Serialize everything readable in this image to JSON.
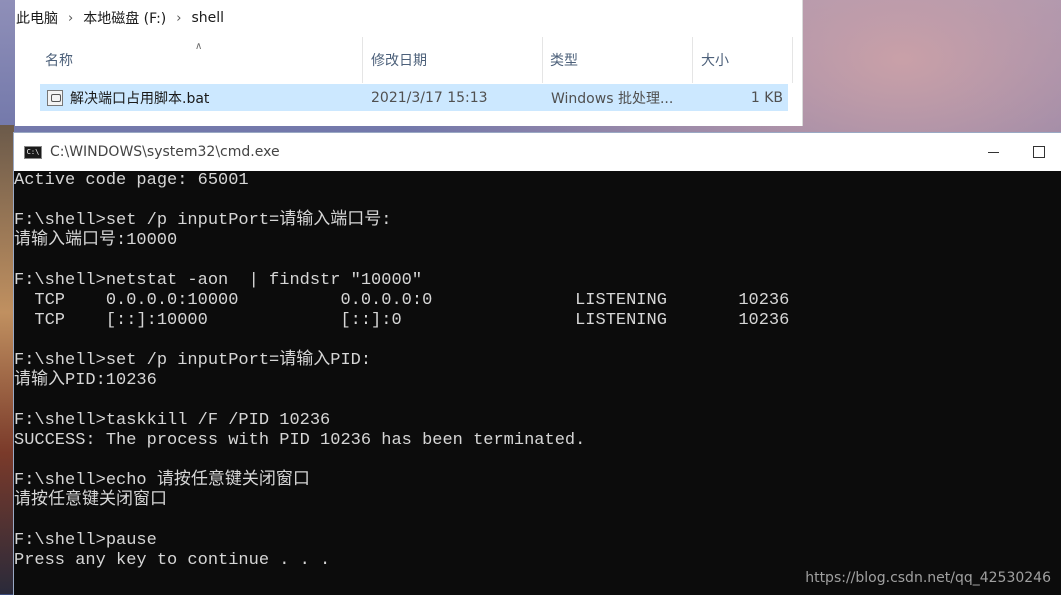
{
  "explorer": {
    "breadcrumb": [
      "此电脑",
      "本地磁盘 (F:)",
      "shell"
    ],
    "columns": {
      "name": "名称",
      "date": "修改日期",
      "type": "类型",
      "size": "大小"
    },
    "file": {
      "name": "解决端口占用脚本.bat",
      "date": "2021/3/17 15:13",
      "type": "Windows 批处理...",
      "size": "1 KB"
    }
  },
  "cmd": {
    "title": "C:\\WINDOWS\\system32\\cmd.exe",
    "lines": [
      "Active code page: 65001",
      "",
      "F:\\shell>set /p inputPort=请输入端口号:",
      "请输入端口号:10000",
      "",
      "F:\\shell>netstat -aon  | findstr \"10000\"",
      "  TCP    0.0.0.0:10000          0.0.0.0:0              LISTENING       10236",
      "  TCP    [::]:10000             [::]:0                 LISTENING       10236",
      "",
      "F:\\shell>set /p inputPort=请输入PID:",
      "请输入PID:10236",
      "",
      "F:\\shell>taskkill /F /PID 10236",
      "SUCCESS: The process with PID 10236 has been terminated.",
      "",
      "F:\\shell>echo 请按任意键关闭窗口",
      "请按任意键关闭窗口",
      "",
      "F:\\shell>pause",
      "Press any key to continue . . ."
    ]
  },
  "watermark": "https://blog.csdn.net/qq_42530246",
  "icons": [
    "chevron-right-icon",
    "sort-up-icon",
    "bat-file-icon",
    "cmd-app-icon",
    "minimize-icon",
    "maximize-icon"
  ]
}
